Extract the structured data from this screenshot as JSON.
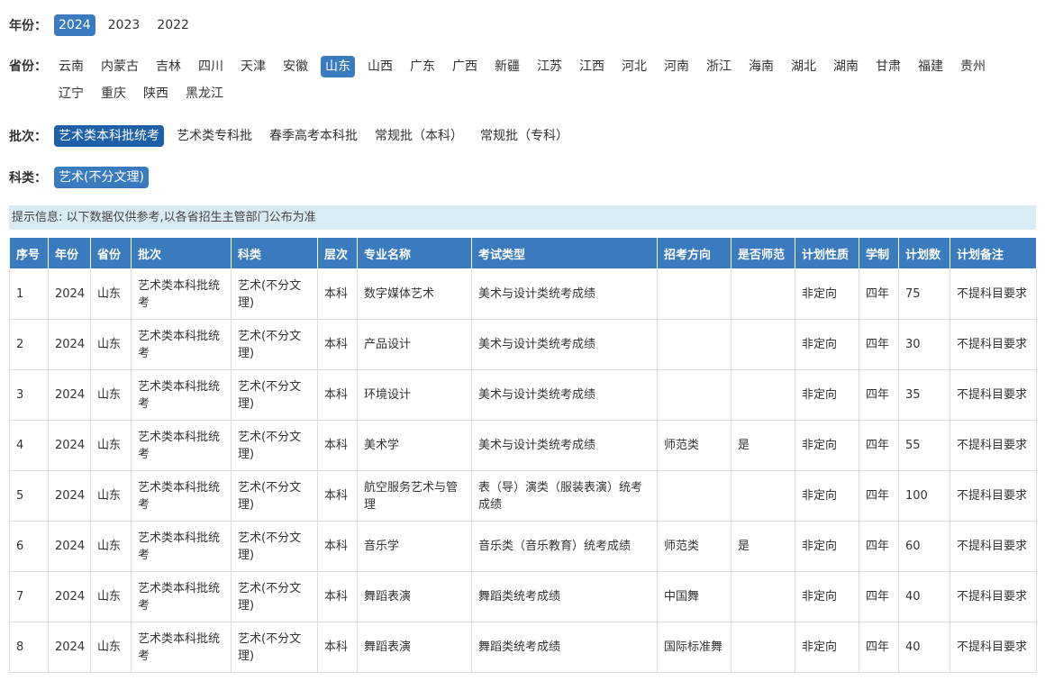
{
  "filters": {
    "year": {
      "label": "年份：",
      "options": [
        "2024",
        "2023",
        "2022"
      ],
      "active": "2024"
    },
    "province": {
      "label": "省份：",
      "options": [
        "云南",
        "内蒙古",
        "吉林",
        "四川",
        "天津",
        "安徽",
        "山东",
        "山西",
        "广东",
        "广西",
        "新疆",
        "江苏",
        "江西",
        "河北",
        "河南",
        "浙江",
        "海南",
        "湖北",
        "湖南",
        "甘肃",
        "福建",
        "贵州",
        "辽宁",
        "重庆",
        "陕西",
        "黑龙江"
      ],
      "active": "山东"
    },
    "batch": {
      "label": "批次：",
      "options": [
        "艺术类本科批统考",
        "艺术类专科批",
        "春季高考本科批",
        "常规批（本科）",
        "常规批（专科）"
      ],
      "active": "艺术类本科批统考"
    },
    "category": {
      "label": "科类：",
      "options": [
        "艺术(不分文理)"
      ],
      "active": "艺术(不分文理)"
    }
  },
  "notice": "提示信息: 以下数据仅供参考,以各省招生主管部门公布为准",
  "table": {
    "headers": [
      "序号",
      "年份",
      "省份",
      "批次",
      "科类",
      "层次",
      "专业名称",
      "考试类型",
      "招考方向",
      "是否师范",
      "计划性质",
      "学制",
      "计划数",
      "计划备注"
    ],
    "rows": [
      [
        "1",
        "2024",
        "山东",
        "艺术类本科批统考",
        "艺术(不分文理)",
        "本科",
        "数字媒体艺术",
        "美术与设计类统考成绩",
        "",
        "",
        "非定向",
        "四年",
        "75",
        "不提科目要求"
      ],
      [
        "2",
        "2024",
        "山东",
        "艺术类本科批统考",
        "艺术(不分文理)",
        "本科",
        "产品设计",
        "美术与设计类统考成绩",
        "",
        "",
        "非定向",
        "四年",
        "30",
        "不提科目要求"
      ],
      [
        "3",
        "2024",
        "山东",
        "艺术类本科批统考",
        "艺术(不分文理)",
        "本科",
        "环境设计",
        "美术与设计类统考成绩",
        "",
        "",
        "非定向",
        "四年",
        "35",
        "不提科目要求"
      ],
      [
        "4",
        "2024",
        "山东",
        "艺术类本科批统考",
        "艺术(不分文理)",
        "本科",
        "美术学",
        "美术与设计类统考成绩",
        "师范类",
        "是",
        "非定向",
        "四年",
        "55",
        "不提科目要求"
      ],
      [
        "5",
        "2024",
        "山东",
        "艺术类本科批统考",
        "艺术(不分文理)",
        "本科",
        "航空服务艺术与管理",
        "表（导）演类（服装表演）统考成绩",
        "",
        "",
        "非定向",
        "四年",
        "100",
        "不提科目要求"
      ],
      [
        "6",
        "2024",
        "山东",
        "艺术类本科批统考",
        "艺术(不分文理)",
        "本科",
        "音乐学",
        "音乐类（音乐教育）统考成绩",
        "师范类",
        "是",
        "非定向",
        "四年",
        "60",
        "不提科目要求"
      ],
      [
        "7",
        "2024",
        "山东",
        "艺术类本科批统考",
        "艺术(不分文理)",
        "本科",
        "舞蹈表演",
        "舞蹈类统考成绩",
        "中国舞",
        "",
        "非定向",
        "四年",
        "40",
        "不提科目要求"
      ],
      [
        "8",
        "2024",
        "山东",
        "艺术类本科批统考",
        "艺术(不分文理)",
        "本科",
        "舞蹈表演",
        "舞蹈类统考成绩",
        "国际标准舞",
        "",
        "非定向",
        "四年",
        "40",
        "不提科目要求"
      ]
    ]
  }
}
